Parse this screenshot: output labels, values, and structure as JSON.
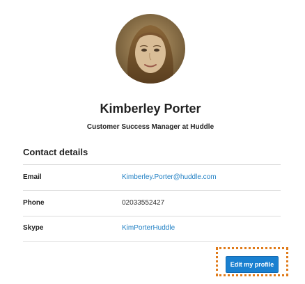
{
  "profile": {
    "avatar_icon": "user-photo",
    "name": "Kimberley Porter",
    "job_title": "Customer Success Manager at Huddle"
  },
  "contact": {
    "title": "Contact details",
    "rows": [
      {
        "label": "Email",
        "value": "Kimberley.Porter@huddle.com",
        "is_link": true
      },
      {
        "label": "Phone",
        "value": "02033552427",
        "is_link": false
      },
      {
        "label": "Skype",
        "value": "KimPorterHuddle",
        "is_link": true
      }
    ]
  },
  "actions": {
    "edit_label": "Edit my profile"
  },
  "colors": {
    "link": "#1f7fc4",
    "button": "#1a80d0",
    "highlight": "#e07b1a"
  }
}
